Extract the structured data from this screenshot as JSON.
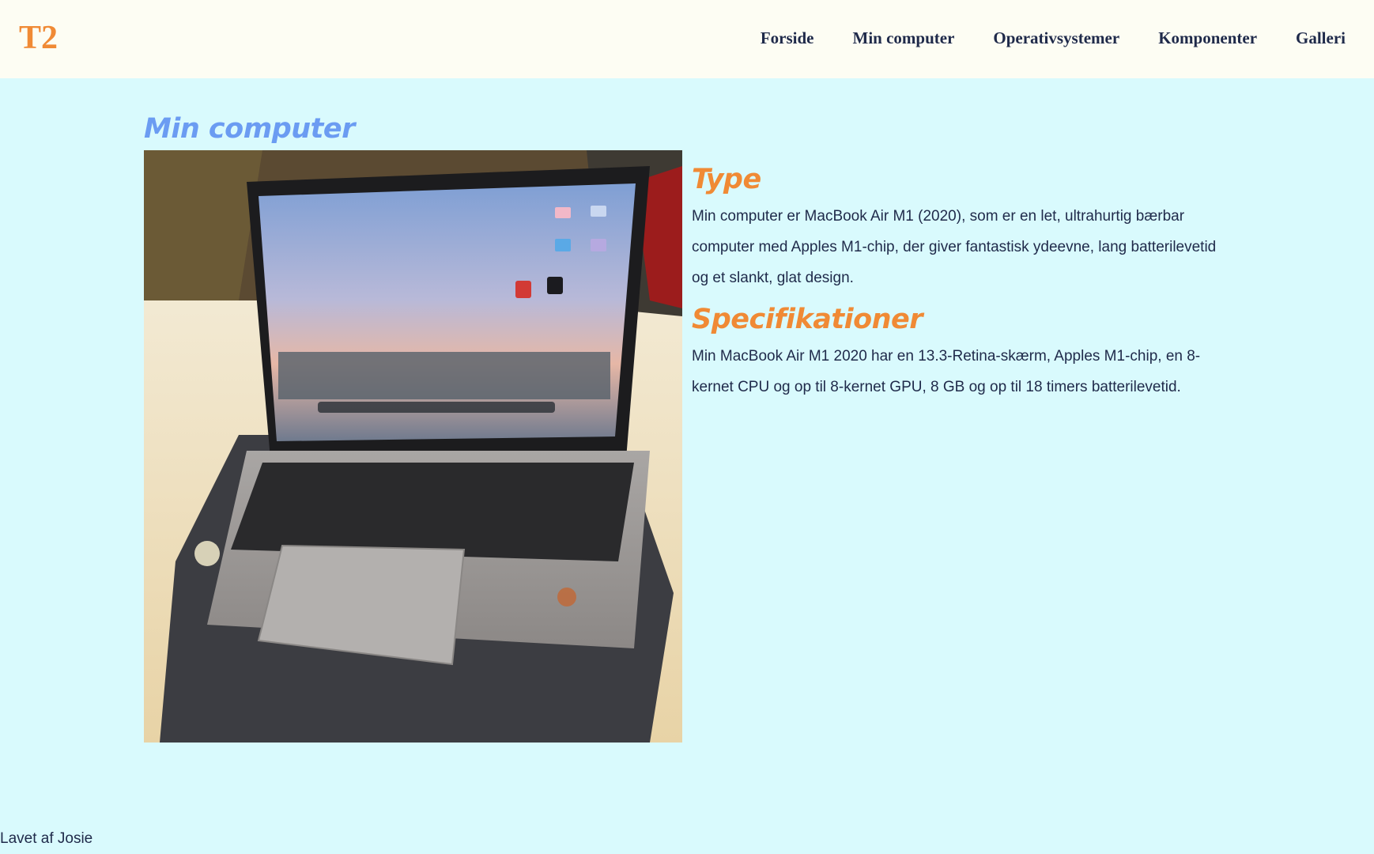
{
  "header": {
    "logo": "T2",
    "nav": [
      {
        "label": "Forside"
      },
      {
        "label": "Min computer"
      },
      {
        "label": "Operativsystemer"
      },
      {
        "label": "Komponenter"
      },
      {
        "label": "Galleri"
      }
    ]
  },
  "main": {
    "title": "Min computer",
    "image_alt": "MacBook Air",
    "sections": [
      {
        "heading": "Type",
        "text": "Min computer er MacBook Air M1 (2020), som er en let, ultrahurtig bærbar computer med Apples M1-chip, der giver fantastisk ydeevne, lang batterilevetid og et slankt, glat design."
      },
      {
        "heading": "Specifikationer",
        "text": "Min MacBook Air M1 2020 har en 13.3-Retina-skærm, Apples M1-chip, en 8-kernet CPU og op til 8-kernet GPU, 8 GB og op til 18 timers batterilevetid."
      }
    ]
  },
  "footer": {
    "text": "Lavet af Josie"
  },
  "colors": {
    "header_bg": "#fdfdf3",
    "page_bg": "#d9fafd",
    "accent_orange": "#f08a35",
    "title_blue": "#6b9cf2",
    "text_navy": "#1f2a4a"
  }
}
